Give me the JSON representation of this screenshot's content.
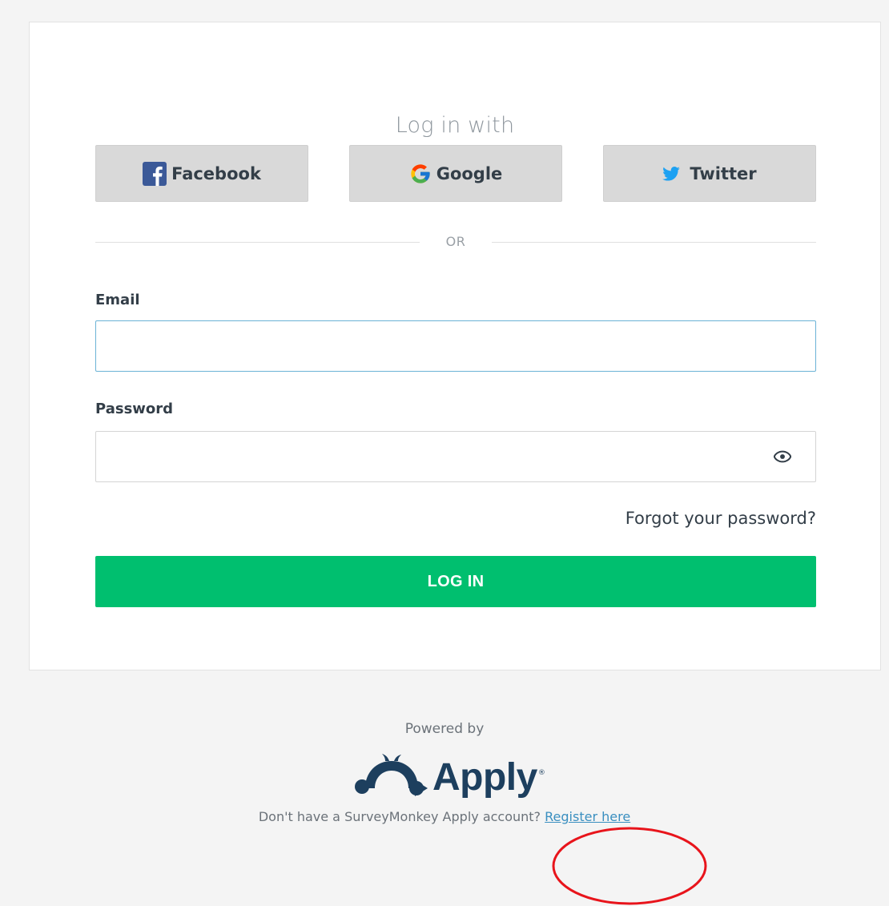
{
  "login": {
    "heading": "Log in with",
    "social": [
      {
        "id": "facebook",
        "label": "Facebook"
      },
      {
        "id": "google",
        "label": "Google"
      },
      {
        "id": "twitter",
        "label": "Twitter"
      }
    ],
    "divider_text": "OR",
    "email": {
      "label": "Email",
      "value": "",
      "placeholder": ""
    },
    "password": {
      "label": "Password",
      "value": "",
      "placeholder": ""
    },
    "forgot_text": "Forgot your password?",
    "submit_label": "LOG IN"
  },
  "footer": {
    "powered_by": "Powered by",
    "logo_text": "Apply",
    "logo_reg": "®",
    "register_prompt": "Don't have a SurveyMonkey Apply account?",
    "register_link": "Register here"
  },
  "icons": {
    "facebook": "facebook-icon",
    "google": "google-icon",
    "twitter": "twitter-icon",
    "eye": "eye-icon",
    "logo": "surveymonkey-logo-icon"
  },
  "colors": {
    "page_bg": "#f4f4f4",
    "card_bg": "#ffffff",
    "social_btn_bg": "#d9d9d9",
    "primary_green": "#00bf6f",
    "link_blue": "#3a8fc0",
    "input_focus_border": "#6bb3d6",
    "logo_navy": "#1d3f5e",
    "facebook_blue": "#3b5998",
    "twitter_blue": "#1da1f2",
    "annotation_red": "#e8141b"
  }
}
